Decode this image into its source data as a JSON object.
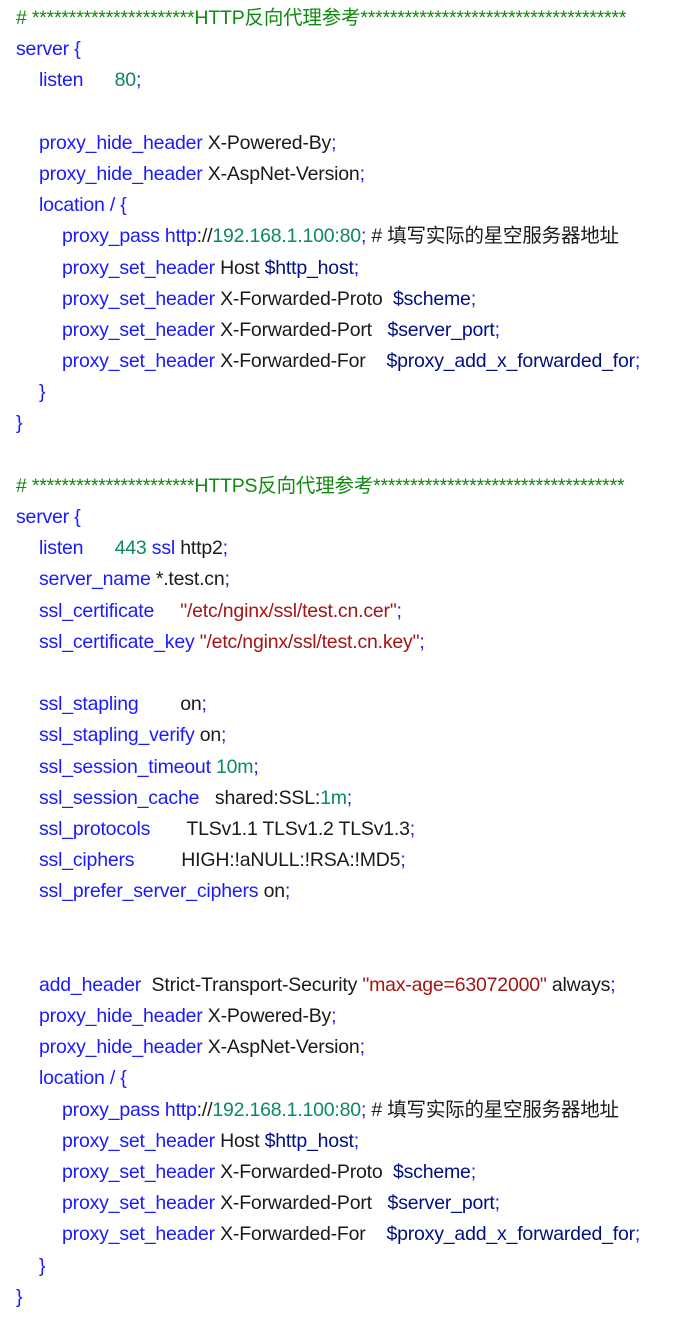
{
  "document": {
    "type": "nginx configuration snippet",
    "sections": [
      {
        "title_comment": "# **********************HTTP反向代理参考************************************",
        "lines": [
          {
            "indent": 0,
            "tokens": [
              {
                "t": "kw",
                "v": "server {"
              }
            ]
          },
          {
            "indent": 1,
            "tokens": [
              {
                "t": "kw",
                "v": "listen"
              },
              {
                "t": "txt",
                "v": "      "
              },
              {
                "t": "num",
                "v": "80"
              },
              {
                "t": "punc",
                "v": ";"
              }
            ]
          },
          {
            "indent": 0,
            "tokens": []
          },
          {
            "indent": 1,
            "tokens": [
              {
                "t": "kw",
                "v": "proxy_hide_header"
              },
              {
                "t": "txt",
                "v": " X-Powered-By"
              },
              {
                "t": "punc",
                "v": ";"
              }
            ]
          },
          {
            "indent": 1,
            "tokens": [
              {
                "t": "kw",
                "v": "proxy_hide_header"
              },
              {
                "t": "txt",
                "v": " X-AspNet-Version"
              },
              {
                "t": "punc",
                "v": ";"
              }
            ]
          },
          {
            "indent": 1,
            "tokens": [
              {
                "t": "kw",
                "v": "location / {"
              }
            ]
          },
          {
            "indent": 2,
            "tokens": [
              {
                "t": "kw",
                "v": "proxy_pass http"
              },
              {
                "t": "txt",
                "v": "://"
              },
              {
                "t": "num",
                "v": "192.168.1.100:80"
              },
              {
                "t": "punc",
                "v": ";"
              },
              {
                "t": "cmt",
                "v": " # 填写实际的星空服务器地址"
              }
            ]
          },
          {
            "indent": 2,
            "tokens": [
              {
                "t": "kw",
                "v": "proxy_set_header"
              },
              {
                "t": "txt",
                "v": " Host "
              },
              {
                "t": "var",
                "v": "$http_host"
              },
              {
                "t": "punc",
                "v": ";"
              }
            ]
          },
          {
            "indent": 2,
            "tokens": [
              {
                "t": "kw",
                "v": "proxy_set_header"
              },
              {
                "t": "txt",
                "v": " X-Forwarded-Proto  "
              },
              {
                "t": "var",
                "v": "$scheme"
              },
              {
                "t": "punc",
                "v": ";"
              }
            ]
          },
          {
            "indent": 2,
            "tokens": [
              {
                "t": "kw",
                "v": "proxy_set_header"
              },
              {
                "t": "txt",
                "v": " X-Forwarded-Port   "
              },
              {
                "t": "var",
                "v": "$server_port"
              },
              {
                "t": "punc",
                "v": ";"
              }
            ]
          },
          {
            "indent": 2,
            "tokens": [
              {
                "t": "kw",
                "v": "proxy_set_header"
              },
              {
                "t": "txt",
                "v": " X-Forwarded-For    "
              },
              {
                "t": "var",
                "v": "$proxy_add_x_forwarded_for"
              },
              {
                "t": "punc",
                "v": ";"
              }
            ]
          },
          {
            "indent": 1,
            "tokens": [
              {
                "t": "brace",
                "v": "}"
              }
            ]
          },
          {
            "indent": 0,
            "tokens": [
              {
                "t": "brace",
                "v": "}"
              }
            ]
          },
          {
            "indent": 0,
            "tokens": []
          }
        ]
      },
      {
        "title_comment": "# **********************HTTPS反向代理参考**********************************",
        "lines": [
          {
            "indent": 0,
            "tokens": [
              {
                "t": "kw",
                "v": "server {"
              }
            ]
          },
          {
            "indent": 1,
            "tokens": [
              {
                "t": "kw",
                "v": "listen"
              },
              {
                "t": "txt",
                "v": "      "
              },
              {
                "t": "num",
                "v": "443"
              },
              {
                "t": "kw",
                "v": " ssl"
              },
              {
                "t": "txt",
                "v": " http2"
              },
              {
                "t": "punc",
                "v": ";"
              }
            ]
          },
          {
            "indent": 1,
            "tokens": [
              {
                "t": "kw",
                "v": "server_name"
              },
              {
                "t": "txt",
                "v": " *.test.cn"
              },
              {
                "t": "punc",
                "v": ";"
              }
            ]
          },
          {
            "indent": 1,
            "tokens": [
              {
                "t": "kw",
                "v": "ssl_certificate"
              },
              {
                "t": "txt",
                "v": "     "
              },
              {
                "t": "str",
                "v": "\"/etc/nginx/ssl/test.cn.cer\""
              },
              {
                "t": "punc",
                "v": ";"
              }
            ]
          },
          {
            "indent": 1,
            "tokens": [
              {
                "t": "kw",
                "v": "ssl_certificate_key"
              },
              {
                "t": "txt",
                "v": " "
              },
              {
                "t": "str",
                "v": "\"/etc/nginx/ssl/test.cn.key\""
              },
              {
                "t": "punc",
                "v": ";"
              }
            ]
          },
          {
            "indent": 0,
            "tokens": []
          },
          {
            "indent": 1,
            "tokens": [
              {
                "t": "kw",
                "v": "ssl_stapling"
              },
              {
                "t": "txt",
                "v": "        on"
              },
              {
                "t": "punc",
                "v": ";"
              }
            ]
          },
          {
            "indent": 1,
            "tokens": [
              {
                "t": "kw",
                "v": "ssl_stapling_verify"
              },
              {
                "t": "txt",
                "v": " on"
              },
              {
                "t": "punc",
                "v": ";"
              }
            ]
          },
          {
            "indent": 1,
            "tokens": [
              {
                "t": "kw",
                "v": "ssl_session_timeout"
              },
              {
                "t": "txt",
                "v": " "
              },
              {
                "t": "num",
                "v": "10m"
              },
              {
                "t": "punc",
                "v": ";"
              }
            ]
          },
          {
            "indent": 1,
            "tokens": [
              {
                "t": "kw",
                "v": "ssl_session_cache"
              },
              {
                "t": "txt",
                "v": "   shared:SSL:"
              },
              {
                "t": "num",
                "v": "1m"
              },
              {
                "t": "punc",
                "v": ";"
              }
            ]
          },
          {
            "indent": 1,
            "tokens": [
              {
                "t": "kw",
                "v": "ssl_protocols"
              },
              {
                "t": "txt",
                "v": "       TLSv1.1 TLSv1.2 TLSv1.3"
              },
              {
                "t": "punc",
                "v": ";"
              }
            ]
          },
          {
            "indent": 1,
            "tokens": [
              {
                "t": "kw",
                "v": "ssl_ciphers"
              },
              {
                "t": "txt",
                "v": "         HIGH:!aNULL:!RSA:!MD5"
              },
              {
                "t": "punc",
                "v": ";"
              }
            ]
          },
          {
            "indent": 1,
            "tokens": [
              {
                "t": "kw",
                "v": "ssl_prefer_server_ciphers"
              },
              {
                "t": "txt",
                "v": " on"
              },
              {
                "t": "punc",
                "v": ";"
              }
            ]
          },
          {
            "indent": 0,
            "tokens": []
          },
          {
            "indent": 0,
            "tokens": []
          },
          {
            "indent": 1,
            "tokens": [
              {
                "t": "kw",
                "v": "add_header"
              },
              {
                "t": "txt",
                "v": "  Strict-Transport-Security "
              },
              {
                "t": "str",
                "v": "\"max-age=63072000\""
              },
              {
                "t": "txt",
                "v": " always"
              },
              {
                "t": "punc",
                "v": ";"
              }
            ]
          },
          {
            "indent": 1,
            "tokens": [
              {
                "t": "kw",
                "v": "proxy_hide_header"
              },
              {
                "t": "txt",
                "v": " X-Powered-By"
              },
              {
                "t": "punc",
                "v": ";"
              }
            ]
          },
          {
            "indent": 1,
            "tokens": [
              {
                "t": "kw",
                "v": "proxy_hide_header"
              },
              {
                "t": "txt",
                "v": " X-AspNet-Version"
              },
              {
                "t": "punc",
                "v": ";"
              }
            ]
          },
          {
            "indent": 1,
            "tokens": [
              {
                "t": "kw",
                "v": "location / {"
              }
            ]
          },
          {
            "indent": 2,
            "tokens": [
              {
                "t": "kw",
                "v": "proxy_pass http"
              },
              {
                "t": "txt",
                "v": "://"
              },
              {
                "t": "num",
                "v": "192.168.1.100:80"
              },
              {
                "t": "punc",
                "v": ";"
              },
              {
                "t": "cmt",
                "v": " # 填写实际的星空服务器地址"
              }
            ]
          },
          {
            "indent": 2,
            "tokens": [
              {
                "t": "kw",
                "v": "proxy_set_header"
              },
              {
                "t": "txt",
                "v": " Host "
              },
              {
                "t": "var",
                "v": "$http_host"
              },
              {
                "t": "punc",
                "v": ";"
              }
            ]
          },
          {
            "indent": 2,
            "tokens": [
              {
                "t": "kw",
                "v": "proxy_set_header"
              },
              {
                "t": "txt",
                "v": " X-Forwarded-Proto  "
              },
              {
                "t": "var",
                "v": "$scheme"
              },
              {
                "t": "punc",
                "v": ";"
              }
            ]
          },
          {
            "indent": 2,
            "tokens": [
              {
                "t": "kw",
                "v": "proxy_set_header"
              },
              {
                "t": "txt",
                "v": " X-Forwarded-Port   "
              },
              {
                "t": "var",
                "v": "$server_port"
              },
              {
                "t": "punc",
                "v": ";"
              }
            ]
          },
          {
            "indent": 2,
            "tokens": [
              {
                "t": "kw",
                "v": "proxy_set_header"
              },
              {
                "t": "txt",
                "v": " X-Forwarded-For    "
              },
              {
                "t": "var",
                "v": "$proxy_add_x_forwarded_for"
              },
              {
                "t": "punc",
                "v": ";"
              }
            ]
          },
          {
            "indent": 1,
            "tokens": [
              {
                "t": "brace",
                "v": "}"
              }
            ]
          },
          {
            "indent": 0,
            "tokens": [
              {
                "t": "brace",
                "v": "}"
              }
            ]
          }
        ]
      }
    ]
  },
  "colors": {
    "keyword": "#1a1aff",
    "number": "#0b8a5e",
    "string": "#a31515",
    "variable": "#001080",
    "header_comment": "#108a10",
    "text": "#1a1a1a"
  }
}
